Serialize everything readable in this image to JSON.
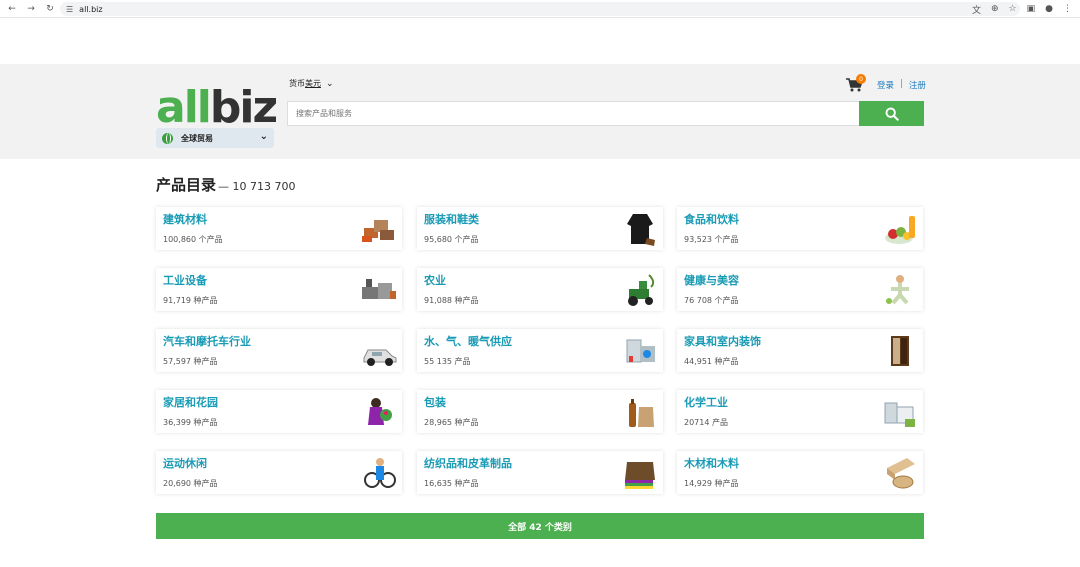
{
  "browser": {
    "url": "all.biz"
  },
  "header": {
    "logo_all": "all",
    "logo_biz": "biz",
    "currency_label": "货币",
    "currency_value": "美元",
    "region": "全球贸易",
    "search_placeholder": "搜索产品和服务",
    "cart_count": "0",
    "login": "登录",
    "separator": "|",
    "register": "注册"
  },
  "catalog": {
    "title": "产品目录",
    "total": "— 10 713 700",
    "categories": [
      {
        "name": "建筑材料",
        "count": "100,860 个产品",
        "icon": "building-materials-icon"
      },
      {
        "name": "服装和鞋类",
        "count": "95,680 个产品",
        "icon": "clothing-icon"
      },
      {
        "name": "食品和饮料",
        "count": "93,523 个产品",
        "icon": "food-icon"
      },
      {
        "name": "工业设备",
        "count": "91,719 种产品",
        "icon": "industrial-equipment-icon"
      },
      {
        "name": "农业",
        "count": "91,088 种产品",
        "icon": "tractor-icon"
      },
      {
        "name": "健康与美容",
        "count": "76 708 个产品",
        "icon": "wellness-icon"
      },
      {
        "name": "汽车和摩托车行业",
        "count": "57,597 种产品",
        "icon": "car-icon"
      },
      {
        "name": "水、气、暖气供应",
        "count": "55 135 产品",
        "icon": "boiler-icon"
      },
      {
        "name": "家具和室内装饰",
        "count": "44,951 种产品",
        "icon": "wardrobe-icon"
      },
      {
        "name": "家居和花园",
        "count": "36,399 种产品",
        "icon": "garden-icon"
      },
      {
        "name": "包装",
        "count": "28,965 种产品",
        "icon": "packaging-icon"
      },
      {
        "name": "化学工业",
        "count": "20714 产品",
        "icon": "chemical-icon"
      },
      {
        "name": "运动休闲",
        "count": "20,690 种产品",
        "icon": "sports-icon"
      },
      {
        "name": "纺织品和皮革制品",
        "count": "16,635 种产品",
        "icon": "textile-icon"
      },
      {
        "name": "木材和木料",
        "count": "14,929 种产品",
        "icon": "wood-icon"
      }
    ],
    "all_button": "全部 42 个类别"
  },
  "colors": {
    "brand_green": "#4caf50",
    "link_teal": "#1a9bb5",
    "link_blue": "#1a7bbf",
    "badge_orange": "#f57c00"
  }
}
